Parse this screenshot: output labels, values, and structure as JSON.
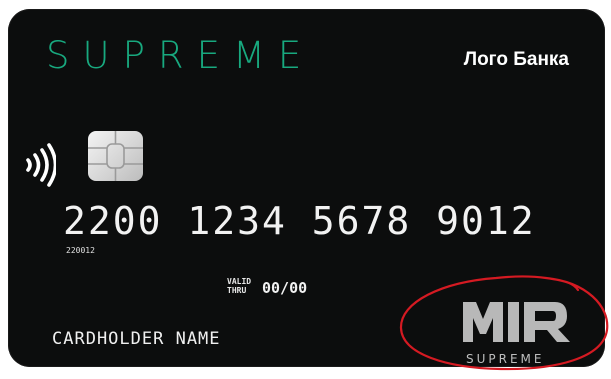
{
  "card": {
    "brand": "SUPREME",
    "bank_logo": "Лого Банка",
    "number": "2200 1234 5678 9012",
    "bin": "220012",
    "valid_thru_label_1": "VALID",
    "valid_thru_label_2": "THRU",
    "valid_thru": "00/00",
    "cardholder": "CARDHOLDER NAME",
    "payment_system": {
      "logo_text": "MIR",
      "tier": "SUPREME"
    }
  },
  "colors": {
    "card_background": "#0c0d0d",
    "brand_green": "#18a97f",
    "annotation_red": "#d51a22",
    "mir_logo_gray": "#b8b8b8"
  },
  "icons": [
    "contactless-icon",
    "chip-icon",
    "mir-logo-icon"
  ]
}
